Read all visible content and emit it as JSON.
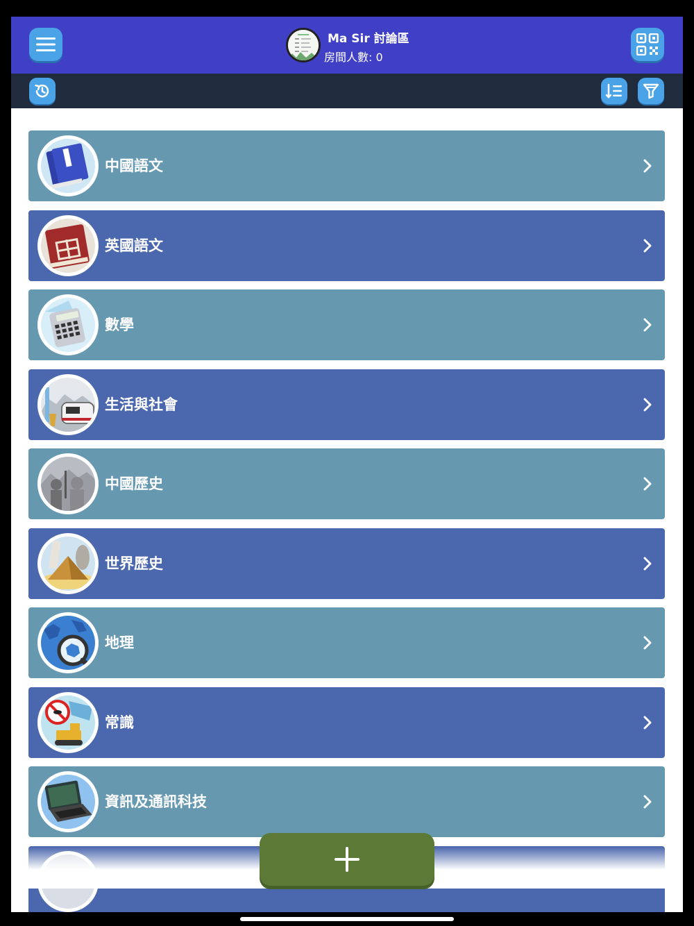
{
  "header": {
    "title": "Ma Sir 討論區",
    "subtitle": "房間人數: 0",
    "menu_icon": "hamburger-menu-icon",
    "qr_icon": "qr-code-icon",
    "avatar_icon": "room-avatar"
  },
  "toolbar": {
    "history_icon": "history-icon",
    "sort_icon": "sort-list-icon",
    "filter_icon": "filter-icon"
  },
  "subjects": [
    {
      "label": "中國語文",
      "icon": "chinese-book-icon"
    },
    {
      "label": "英國語文",
      "icon": "english-book-icon"
    },
    {
      "label": "數學",
      "icon": "calculator-icon"
    },
    {
      "label": "生活與社會",
      "icon": "city-train-icon"
    },
    {
      "label": "中國歷史",
      "icon": "terracotta-warrior-icon"
    },
    {
      "label": "世界歷史",
      "icon": "pyramid-icon"
    },
    {
      "label": "地理",
      "icon": "globe-magnifier-icon"
    },
    {
      "label": "常識",
      "icon": "mosquito-bulldozer-icon"
    },
    {
      "label": "資訊及通訊科技",
      "icon": "laptop-icon"
    }
  ],
  "colors": {
    "header_bg": "#4040c6",
    "toolbar_bg": "#212b3e",
    "row_teal": "#6698b0",
    "row_blue": "#4b67ad",
    "button_blue": "#4aa3e6",
    "add_button": "#5c7a36"
  },
  "add_button_icon": "plus-icon"
}
